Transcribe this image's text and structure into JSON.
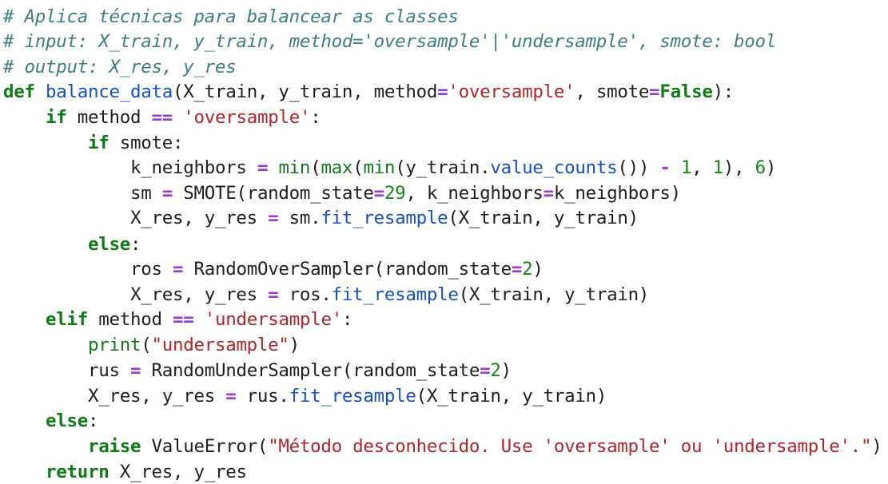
{
  "code": {
    "line1": "# Aplica técnicas para balancear as classes",
    "line2": "# input: X_train, y_train, method='oversample'|'undersample', smote: bool",
    "line3": "# output: X_res, y_res",
    "line4": {
      "kw": "def",
      "fn": "balance_data",
      "a": "(X_train, y_train, method",
      "op1": "=",
      "s1": "'oversample'",
      "b": ", smote",
      "op2": "=",
      "bool": "False",
      "c": "):"
    },
    "line5": {
      "indent": "    ",
      "kw": "if",
      "a": " method ",
      "op": "==",
      "b": " ",
      "s": "'oversample'",
      "c": ":"
    },
    "line6": {
      "indent": "        ",
      "kw": "if",
      "a": " smote:"
    },
    "line7": {
      "indent": "            ",
      "a": "k_neighbors ",
      "op1": "=",
      "b": " ",
      "bi1": "min",
      "c": "(",
      "bi2": "max",
      "d": "(",
      "bi3": "min",
      "e": "(y_train.",
      "fn": "value_counts",
      "f": "()) ",
      "op2": "-",
      "g": " ",
      "n1": "1",
      "h": ", ",
      "n2": "1",
      "i": "), ",
      "n3": "6",
      "j": ")"
    },
    "line8": {
      "indent": "            ",
      "a": "sm ",
      "op1": "=",
      "b": " SMOTE(random_state",
      "op2": "=",
      "n": "29",
      "c": ", k_neighbors",
      "op3": "=",
      "d": "k_neighbors)"
    },
    "line9": {
      "indent": "            ",
      "a": "X_res, y_res ",
      "op": "=",
      "b": " sm.",
      "fn": "fit_resample",
      "c": "(X_train, y_train)"
    },
    "line10": {
      "indent": "        ",
      "kw": "else",
      "a": ":"
    },
    "line11": {
      "indent": "            ",
      "a": "ros ",
      "op1": "=",
      "b": " RandomOverSampler(random_state",
      "op2": "=",
      "n": "2",
      "c": ")"
    },
    "line12": {
      "indent": "            ",
      "a": "X_res, y_res ",
      "op": "=",
      "b": " ros.",
      "fn": "fit_resample",
      "c": "(X_train, y_train)"
    },
    "line13": {
      "indent": "    ",
      "kw": "elif",
      "a": " method ",
      "op": "==",
      "b": " ",
      "s": "'undersample'",
      "c": ":"
    },
    "line14": {
      "indent": "        ",
      "bi": "print",
      "a": "(",
      "s": "\"undersample\"",
      "b": ")"
    },
    "line15": {
      "indent": "        ",
      "a": "rus ",
      "op1": "=",
      "b": " RandomUnderSampler(random_state",
      "op2": "=",
      "n": "2",
      "c": ")"
    },
    "line16": {
      "indent": "        ",
      "a": "X_res, y_res ",
      "op": "=",
      "b": " rus.",
      "fn": "fit_resample",
      "c": "(X_train, y_train)"
    },
    "line17": {
      "indent": "    ",
      "kw": "else",
      "a": ":"
    },
    "line18": {
      "indent": "        ",
      "kw": "raise",
      "a": " ValueError(",
      "s": "\"Método desconhecido. Use 'oversample' ou 'undersample'.\"",
      "b": ")"
    },
    "line19": {
      "indent": "    ",
      "kw": "return",
      "a": " X_res, y_res"
    }
  },
  "colors": {
    "comment": "#3e7e83",
    "keyword": "#0f7b16",
    "function": "#1750c5",
    "string": "#b0252a",
    "number": "#138a13",
    "operator": "#9b38d8",
    "text": "#1f1f1f",
    "background": "#ffffff"
  }
}
